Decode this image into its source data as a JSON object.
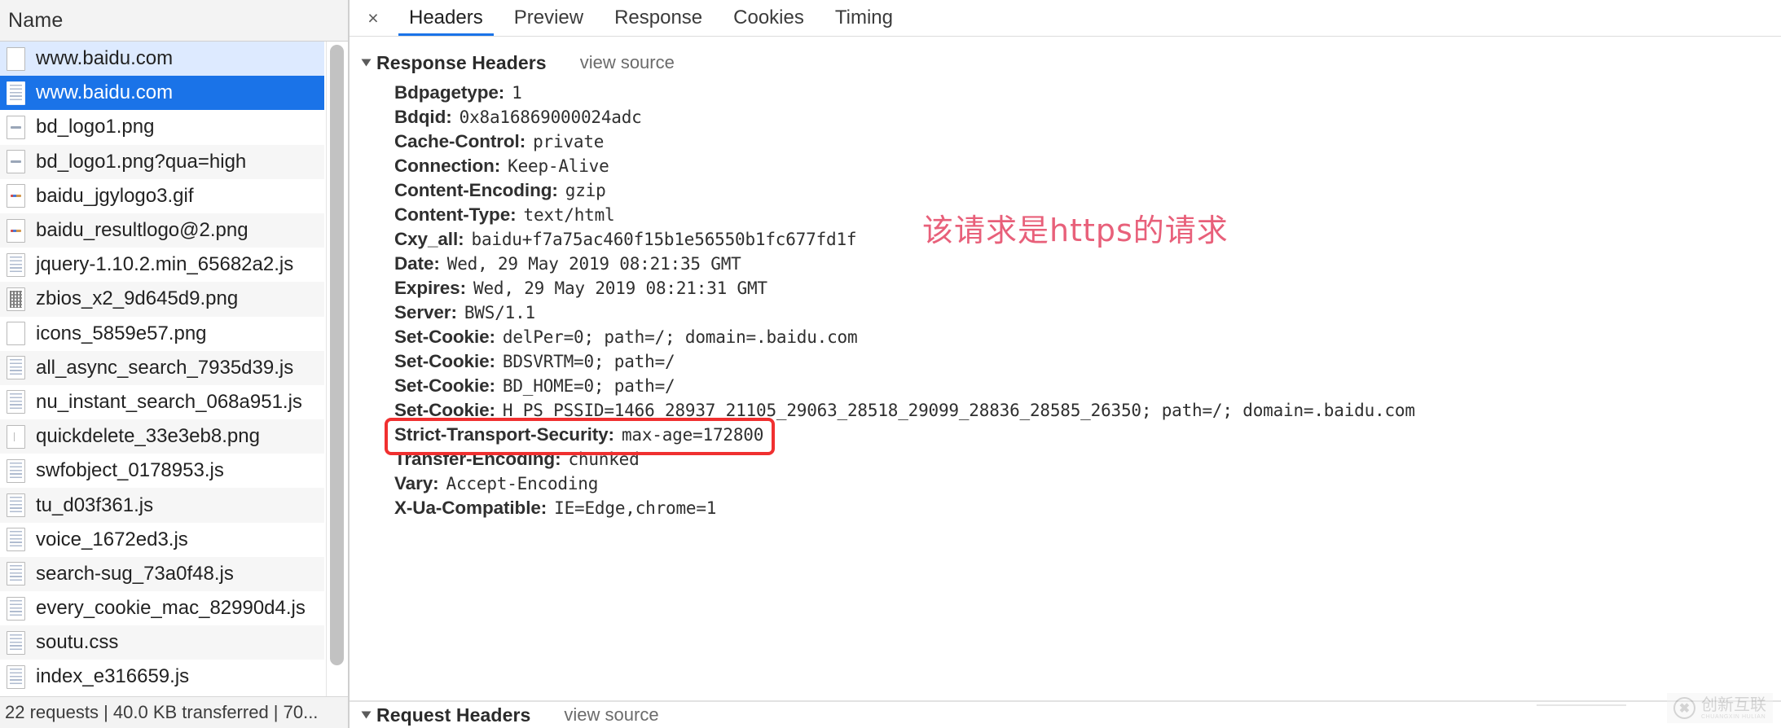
{
  "left": {
    "column_header": "Name",
    "files": [
      {
        "name": "www.baidu.com",
        "icon": "document-icon",
        "state": "hovered"
      },
      {
        "name": "www.baidu.com",
        "icon": "document-lines-icon",
        "state": "selected"
      },
      {
        "name": "bd_logo1.png",
        "icon": "image-icon",
        "state": "normal"
      },
      {
        "name": "bd_logo1.png?qua=high",
        "icon": "image-icon",
        "state": "normal"
      },
      {
        "name": "baidu_jgylogo3.gif",
        "icon": "image-color-icon",
        "state": "normal"
      },
      {
        "name": "baidu_resultlogo@2.png",
        "icon": "image-color-icon",
        "state": "normal"
      },
      {
        "name": "jquery-1.10.2.min_65682a2.js",
        "icon": "script-icon",
        "state": "normal"
      },
      {
        "name": "zbios_x2_9d645d9.png",
        "icon": "qr-image-icon",
        "state": "normal"
      },
      {
        "name": "icons_5859e57.png",
        "icon": "blank-image-icon",
        "state": "normal"
      },
      {
        "name": "all_async_search_7935d39.js",
        "icon": "script-icon",
        "state": "normal"
      },
      {
        "name": "nu_instant_search_068a951.js",
        "icon": "script-icon",
        "state": "normal"
      },
      {
        "name": "quickdelete_33e3eb8.png",
        "icon": "tiny-image-icon",
        "state": "normal"
      },
      {
        "name": "swfobject_0178953.js",
        "icon": "script-icon",
        "state": "normal"
      },
      {
        "name": "tu_d03f361.js",
        "icon": "script-icon",
        "state": "normal"
      },
      {
        "name": "voice_1672ed3.js",
        "icon": "script-icon",
        "state": "normal"
      },
      {
        "name": "search-sug_73a0f48.js",
        "icon": "script-icon",
        "state": "normal"
      },
      {
        "name": "every_cookie_mac_82990d4.js",
        "icon": "script-icon",
        "state": "normal"
      },
      {
        "name": "soutu.css",
        "icon": "style-icon",
        "state": "normal"
      },
      {
        "name": "index_e316659.js",
        "icon": "script-icon",
        "state": "normal"
      }
    ],
    "status_bar": "22 requests | 40.0 KB transferred | 70..."
  },
  "right": {
    "close_label": "×",
    "tabs": [
      {
        "label": "Headers",
        "active": true
      },
      {
        "label": "Preview",
        "active": false
      },
      {
        "label": "Response",
        "active": false
      },
      {
        "label": "Cookies",
        "active": false
      },
      {
        "label": "Timing",
        "active": false
      }
    ],
    "response_section": {
      "title": "Response Headers",
      "view_source": "view source",
      "headers": [
        {
          "name": "Bdpagetype:",
          "value": "1"
        },
        {
          "name": "Bdqid:",
          "value": "0x8a16869000024adc"
        },
        {
          "name": "Cache-Control:",
          "value": "private"
        },
        {
          "name": "Connection:",
          "value": "Keep-Alive"
        },
        {
          "name": "Content-Encoding:",
          "value": "gzip"
        },
        {
          "name": "Content-Type:",
          "value": "text/html"
        },
        {
          "name": "Cxy_all:",
          "value": "baidu+f7a75ac460f15b1e56550b1fc677fd1f"
        },
        {
          "name": "Date:",
          "value": "Wed, 29 May 2019 08:21:35 GMT"
        },
        {
          "name": "Expires:",
          "value": "Wed, 29 May 2019 08:21:31 GMT"
        },
        {
          "name": "Server:",
          "value": "BWS/1.1"
        },
        {
          "name": "Set-Cookie:",
          "value": "delPer=0; path=/; domain=.baidu.com"
        },
        {
          "name": "Set-Cookie:",
          "value": "BDSVRTM=0; path=/"
        },
        {
          "name": "Set-Cookie:",
          "value": "BD_HOME=0; path=/"
        },
        {
          "name": "Set-Cookie:",
          "value": "H_PS_PSSID=1466_28937_21105_29063_28518_29099_28836_28585_26350; path=/; domain=.baidu.com"
        },
        {
          "name": "Strict-Transport-Security:",
          "value": "max-age=172800"
        },
        {
          "name": "Transfer-Encoding:",
          "value": "chunked"
        },
        {
          "name": "Vary:",
          "value": "Accept-Encoding"
        },
        {
          "name": "X-Ua-Compatible:",
          "value": "IE=Edge,chrome=1"
        }
      ]
    },
    "request_section": {
      "title": "Request Headers",
      "view_source": "view source"
    },
    "annotation": "该请求是https的请求",
    "highlight_color": "#f03030",
    "accent_color": "#1a73e8"
  },
  "watermark": {
    "logo_glyph": "✖",
    "cn": "创新互联",
    "en": "CHUANGXIN HULIAN"
  }
}
